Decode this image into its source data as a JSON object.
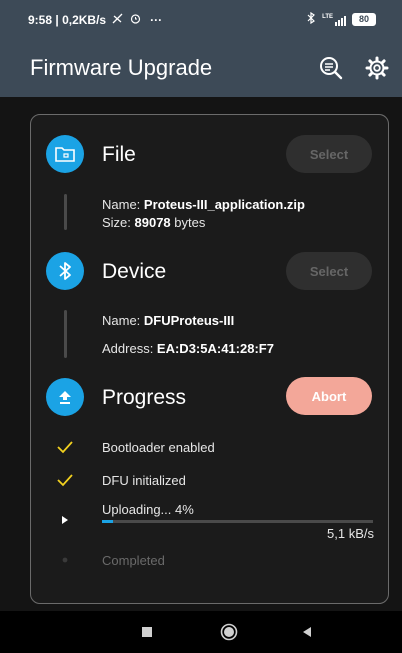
{
  "status_bar": {
    "time": "9:58",
    "speed": "0,2KB/s",
    "more": "···",
    "network": "LTE",
    "battery": "80"
  },
  "app_bar": {
    "title": "Firmware Upgrade"
  },
  "file": {
    "title": "File",
    "select_label": "Select",
    "name_label": "Name: ",
    "name_value": "Proteus-III_application.zip",
    "size_label": "Size: ",
    "size_value": "89078",
    "size_unit": " bytes"
  },
  "device": {
    "title": "Device",
    "select_label": "Select",
    "name_label": "Name: ",
    "name_value": "DFUProteus-III",
    "address_label": "Address: ",
    "address_value": "EA:D3:5A:41:28:F7"
  },
  "progress": {
    "title": "Progress",
    "abort_label": "Abort",
    "steps": [
      {
        "label": "Bootloader enabled",
        "state": "done"
      },
      {
        "label": "DFU initialized",
        "state": "done"
      },
      {
        "label": "Uploading... 4%",
        "state": "active"
      },
      {
        "label": "Completed",
        "state": "pending"
      }
    ],
    "upload_fraction": 0.04,
    "speed": "5,1 kB/s"
  },
  "colors": {
    "accent": "#1ba3e5",
    "check": "#f2d11f",
    "abort": "#f3a799",
    "app_bar": "#3d4a57"
  }
}
